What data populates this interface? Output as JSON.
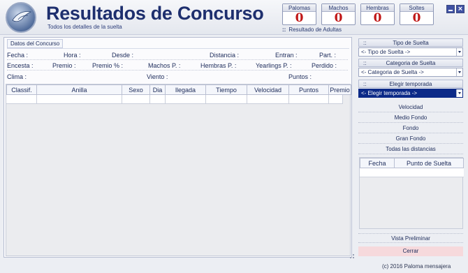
{
  "header": {
    "title": "Resultados de Concurso",
    "subtitle": "Todos los detalles de la suelta",
    "counters": [
      {
        "label": "Palomas",
        "value": "0"
      },
      {
        "label": "Machos",
        "value": "0"
      },
      {
        "label": "Hembras",
        "value": "0"
      },
      {
        "label": "Soltes",
        "value": "0"
      }
    ],
    "resultado_marker": "::",
    "resultado": "Resultado de Adultas"
  },
  "datos": {
    "tab": "Datos del Concurso",
    "fields": {
      "fecha": "Fecha :",
      "hora": "Hora :",
      "desde": "Desde :",
      "distancia": "Distancia :",
      "entran": "Entran :",
      "part": "Part. :",
      "encesta": "Encesta :",
      "premio": "Premio :",
      "premio_pct": "Premio % :",
      "machos_p": "Machos P. :",
      "hembras_p": "Hembras P. :",
      "yearlings_p": "Yearlings P. :",
      "perdido": "Perdido :",
      "clima": "Clima :",
      "viento": "Viento :",
      "puntos": "Puntos :"
    }
  },
  "table": {
    "columns": [
      "Classif.",
      "Anilla",
      "Sexo",
      "Dia",
      "llegada",
      "Tiempo",
      "Velocidad",
      "Puntos",
      "Premio"
    ]
  },
  "side": {
    "tipo_header": "Tipo de Suelta",
    "tipo_value": "<- Tipo de Suelta ->",
    "categoria_header": "Categoria de Suelta",
    "categoria_value": "<- Categoria de Suelta ->",
    "temporada_header": "Elegir temporada",
    "temporada_value": "<- Elegir temporada ->",
    "header_marker": "::",
    "links": [
      "Velocidad",
      "Medio Fondo",
      "Fondo",
      "Gran Fondo",
      "Todas las distancias"
    ],
    "punto_columns": [
      "Fecha",
      "Punto de Suelta"
    ],
    "vista": "Vista Preliminar",
    "cerrar": "Cerrar"
  },
  "footer": {
    "copyright": "(c) 2016 Paloma mensajera"
  },
  "colors": {
    "title": "#1e2f6e",
    "counter_value": "#c01818",
    "selected_combo": "#0c2a88",
    "close_button": "#f6d9dc"
  },
  "icons": [
    "pigeon-logo-icon",
    "minimize-icon",
    "close-icon",
    "dropdown-arrow-icon"
  ]
}
